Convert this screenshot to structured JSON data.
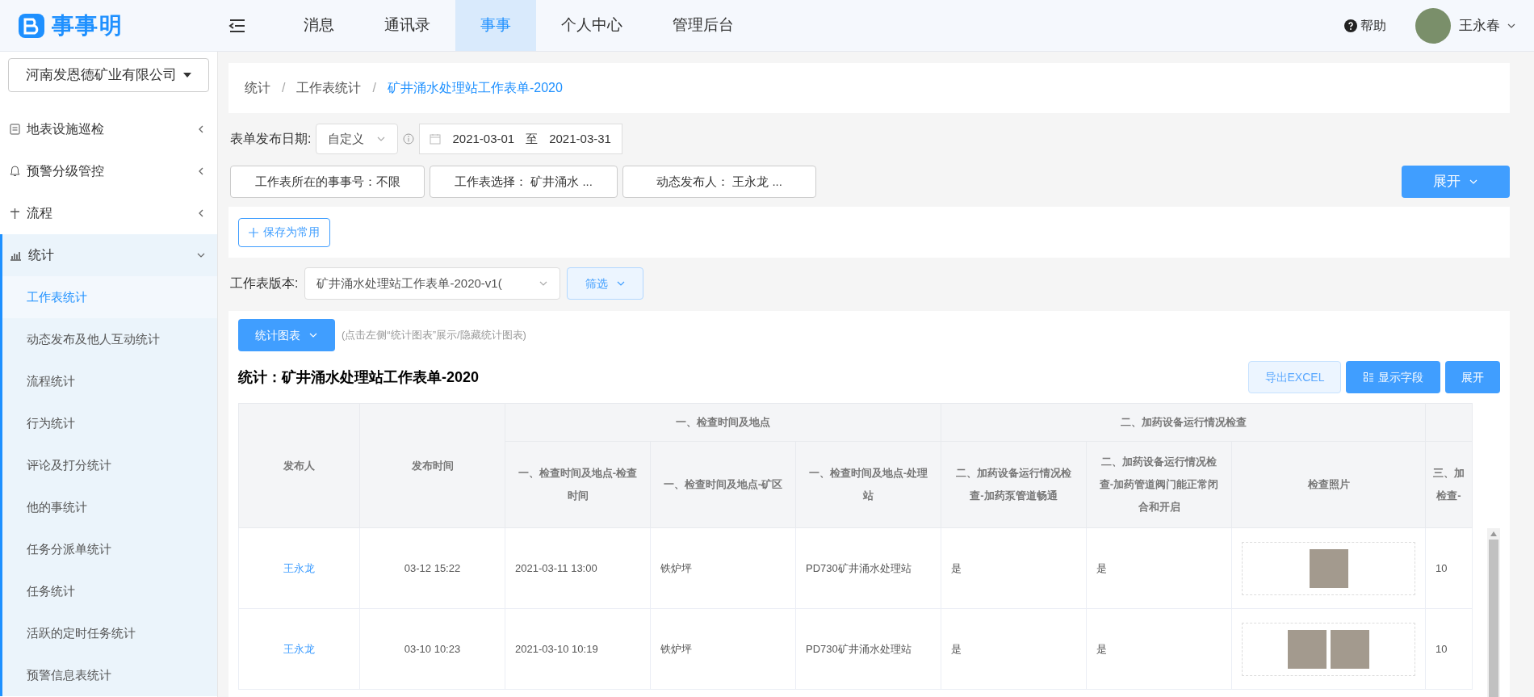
{
  "header": {
    "logo_text": "事事明",
    "nav": [
      {
        "label": "消息",
        "selected": false
      },
      {
        "label": "通讯录",
        "selected": false
      },
      {
        "label": "事事",
        "selected": true
      },
      {
        "label": "个人中心",
        "selected": false
      },
      {
        "label": "管理后台",
        "selected": false
      }
    ],
    "help": "帮助",
    "user": "王永春"
  },
  "sidebar": {
    "company": "河南发恩德矿业有限公司",
    "items": [
      {
        "label": "地表设施巡检",
        "expanded": false
      },
      {
        "label": "预警分级管控",
        "expanded": false
      },
      {
        "label": "流程",
        "expanded": false
      },
      {
        "label": "统计",
        "expanded": true,
        "children": [
          {
            "label": "工作表统计",
            "selected": true
          },
          {
            "label": "动态发布及他人互动统计",
            "selected": false
          },
          {
            "label": "流程统计",
            "selected": false
          },
          {
            "label": "行为统计",
            "selected": false
          },
          {
            "label": "评论及打分统计",
            "selected": false
          },
          {
            "label": "他的事统计",
            "selected": false
          },
          {
            "label": "任务分派单统计",
            "selected": false
          },
          {
            "label": "任务统计",
            "selected": false
          },
          {
            "label": "活跃的定时任务统计",
            "selected": false
          },
          {
            "label": "预警信息表统计",
            "selected": false
          }
        ]
      }
    ]
  },
  "breadcrumb": [
    {
      "label": "统计"
    },
    {
      "separator": "/",
      "label": "工作表统计"
    },
    {
      "separator": "/",
      "label": "矿井涌水处理站工作表单-2020"
    }
  ],
  "filters": {
    "date_label": "表单发布日期:",
    "date_mode": "自定义",
    "date_start": "2021-03-01",
    "date_sep": "至",
    "date_end": "2021-03-31",
    "chips": [
      "工作表所在的事事号：不限",
      "工作表选择： 矿井涌水 ...",
      "动态发布人： 王永龙 ..."
    ],
    "expand_button": "展开",
    "save_button": "保存为常用",
    "version_label": "工作表版本:",
    "version_value": "矿井涌水处理站工作表单-2020-v1(",
    "filter_button": "筛选"
  },
  "stats": {
    "chart_button": "统计图表",
    "hint": "(点击左侧“统计图表”展示/隐藏统计图表)",
    "title": "统计：矿井涌水处理站工作表单-2020",
    "export_button": "导出EXCEL",
    "fields_button": "显示字段",
    "expand_button": "展开"
  },
  "table": {
    "header_rows": [
      [
        {
          "label": "发布人",
          "rowspan": 2
        },
        {
          "label": "发布时间",
          "rowspan": 2
        },
        {
          "label": "一、检查时间及地点",
          "colspan": 3
        },
        {
          "label": "二、加药设备运行情况检查",
          "colspan": 3
        }
      ],
      [
        {
          "label": "一、检查时间及地点-检查时间"
        },
        {
          "label": "一、检查时间及地点-矿区"
        },
        {
          "label": "一、检查时间及地点-处理站"
        },
        {
          "label": "二、加药设备运行情况检查-加药泵管道畅通"
        },
        {
          "label": "二、加药设备运行情况检查-加药管道阀门能正常闭合和开启"
        },
        {
          "label": "检查照片"
        },
        {
          "label": "三、加检查-"
        }
      ]
    ],
    "rows": [
      {
        "publisher": "王永龙",
        "time": "03-12 15:22",
        "cells": [
          "2021-03-11 13:00",
          "铁炉坪",
          "PD730矿井涌水处理站",
          "是",
          "是"
        ],
        "photos": [
          {
            "kind": "photo"
          }
        ],
        "last": "10"
      },
      {
        "publisher": "王永龙",
        "time": "03-10 10:23",
        "cells": [
          "2021-03-10 10:19",
          "铁炉坪",
          "PD730矿井涌水处理站",
          "是",
          "是"
        ],
        "photos": [
          {
            "kind": "photo"
          },
          {
            "kind": "photo"
          }
        ],
        "last": "10"
      }
    ]
  }
}
